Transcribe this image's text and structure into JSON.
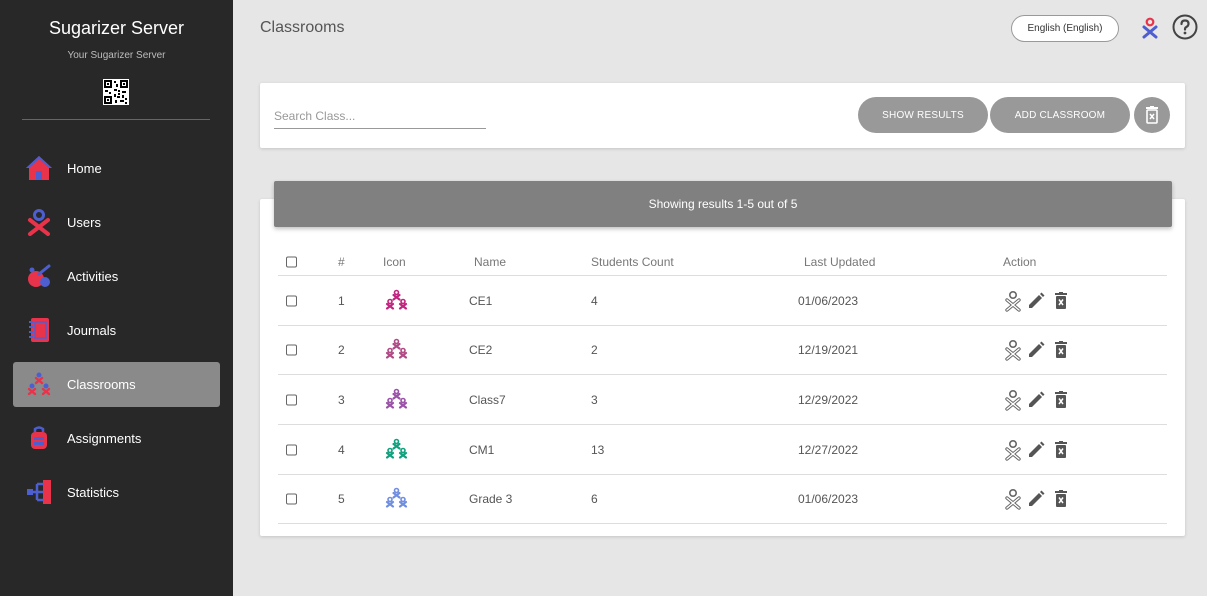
{
  "sidebar": {
    "title": "Sugarizer Server",
    "subtitle": "Your Sugarizer Server",
    "items": [
      {
        "label": "Home",
        "icon": "home-icon"
      },
      {
        "label": "Users",
        "icon": "user-icon"
      },
      {
        "label": "Activities",
        "icon": "activities-icon"
      },
      {
        "label": "Journals",
        "icon": "journal-icon"
      },
      {
        "label": "Classrooms",
        "icon": "classroom-icon",
        "active": true
      },
      {
        "label": "Assignments",
        "icon": "assignment-icon"
      },
      {
        "label": "Statistics",
        "icon": "statistics-icon"
      }
    ]
  },
  "header": {
    "title": "Classrooms",
    "language": "English (English)"
  },
  "search": {
    "placeholder": "Search Class...",
    "show_results": "SHOW RESULTS",
    "add_classroom": "ADD CLASSROOM"
  },
  "results": {
    "banner": "Showing results 1-5 out of 5"
  },
  "table": {
    "headers": {
      "num": "#",
      "icon": "Icon",
      "name": "Name",
      "count": "Students Count",
      "updated": "Last Updated",
      "action": "Action"
    },
    "rows": [
      {
        "num": "1",
        "name": "CE1",
        "count": "4",
        "updated": "01/06/2023",
        "color": "#c2237f"
      },
      {
        "num": "2",
        "name": "CE2",
        "count": "2",
        "updated": "12/19/2021",
        "color": "#b04a86"
      },
      {
        "num": "3",
        "name": "Class7",
        "count": "3",
        "updated": "12/29/2022",
        "color": "#9a52a8"
      },
      {
        "num": "4",
        "name": "CM1",
        "count": "13",
        "updated": "12/27/2022",
        "color": "#10a07d"
      },
      {
        "num": "5",
        "name": "Grade 3",
        "count": "6",
        "updated": "01/06/2023",
        "color": "#6f8ee0"
      }
    ]
  },
  "colors": {
    "sidebar_bg": "#282828",
    "accent_red": "#e8334a",
    "accent_blue": "#4d5fd0"
  }
}
